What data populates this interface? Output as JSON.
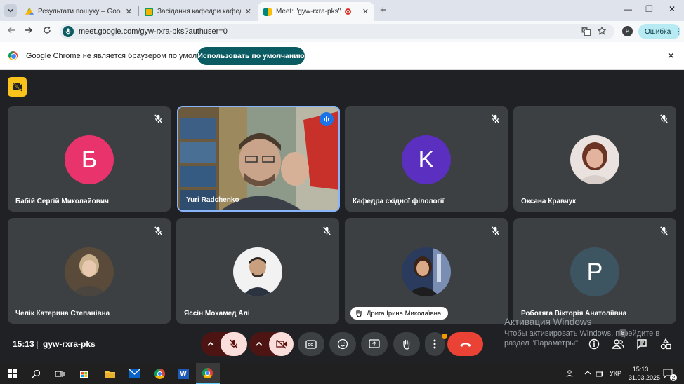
{
  "browser": {
    "tabs": [
      {
        "title": "Результати пошуку – Google Д",
        "favicon_color": "#1a73e8"
      },
      {
        "title": "Засідання кафедри кафедра с",
        "favicon_color": "#f4b400"
      },
      {
        "title": "Meet: \"gyw-rxra-pks\"",
        "favicon_color": "#00897b",
        "active": true
      }
    ],
    "url": "meet.google.com/gyw-rxra-pks?authuser=0",
    "profile_initial": "Р",
    "error_button_label": "Ошибка",
    "infobar_text": "Google Chrome не является браузером по умолчанию.",
    "infobar_button": "Использовать по умолчанию"
  },
  "meet": {
    "participants": [
      {
        "name": "Бабій Сергій Миколайович",
        "initial": "Б",
        "color": "#e8336d",
        "muted": true
      },
      {
        "name": "Yuri Radchenko",
        "video": true,
        "speaking": true
      },
      {
        "name": "Кафедра східної філології",
        "initial": "K",
        "color": "#5b2fbf",
        "muted": true
      },
      {
        "name": "Оксана Кравчук",
        "photo": true,
        "muted": true
      },
      {
        "name": "Челік Катерина Степанівна",
        "photo": true,
        "muted": true
      },
      {
        "name": "Яссін Мохамед Алі",
        "photo": true,
        "muted": true
      },
      {
        "name": "Дрига Ірина Миколаївна",
        "photo": true,
        "muted": true,
        "hand_raised": true
      },
      {
        "name": "Роботяга Вікторія Анатоліївна",
        "initial": "P",
        "color": "#3c5561",
        "muted": true
      }
    ],
    "time": "15:13",
    "meeting_code": "gyw-rxra-pks",
    "people_count": "8",
    "watermark_title": "Активация Windows",
    "watermark_text": "Чтобы активировать Windows, перейдите в раздел \"Параметры\"."
  },
  "taskbar": {
    "language": "УКР",
    "time": "15:13",
    "date": "31.03.2025",
    "notifications": "2"
  }
}
